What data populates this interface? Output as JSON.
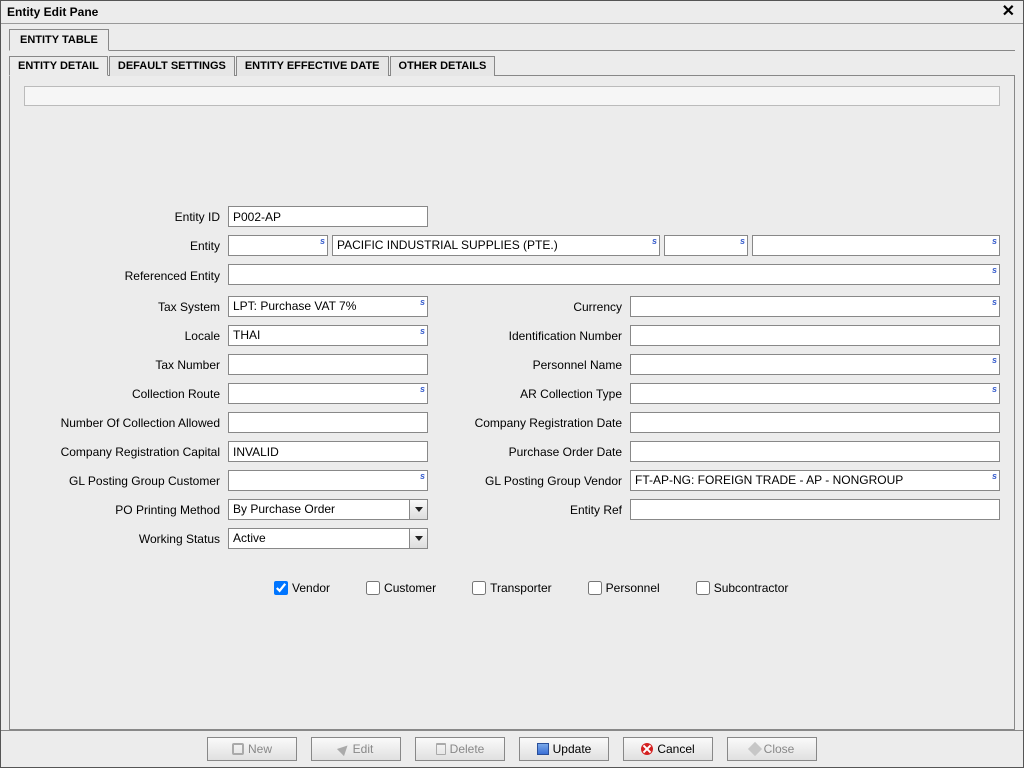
{
  "window": {
    "title": "Entity Edit Pane"
  },
  "outer_tabs": [
    {
      "label": "ENTITY TABLE"
    }
  ],
  "inner_tabs": [
    {
      "label": "ENTITY DETAIL"
    },
    {
      "label": "DEFAULT SETTINGS"
    },
    {
      "label": "ENTITY EFFECTIVE DATE"
    },
    {
      "label": "OTHER DETAILS"
    }
  ],
  "labels": {
    "entity_id": "Entity ID",
    "entity": "Entity",
    "referenced_entity": "Referenced Entity",
    "tax_system": "Tax System",
    "currency": "Currency",
    "locale": "Locale",
    "identification_number": "Identification Number",
    "tax_number": "Tax Number",
    "personnel_name": "Personnel Name",
    "collection_route": "Collection Route",
    "ar_collection_type": "AR Collection Type",
    "num_collection_allowed": "Number Of Collection Allowed",
    "company_registration_date": "Company Registration Date",
    "company_registration_capital": "Company Registration Capital",
    "purchase_order_date": "Purchase Order Date",
    "gl_posting_group_customer": "GL Posting Group Customer",
    "gl_posting_group_vendor": "GL Posting Group Vendor",
    "po_printing_method": "PO Printing Method",
    "entity_ref": "Entity Ref",
    "working_status": "Working Status"
  },
  "fields": {
    "entity_id": "P002-AP",
    "entity_prefix": "",
    "entity_name": "PACIFIC INDUSTRIAL SUPPLIES (PTE.)",
    "entity_aux1": "",
    "entity_aux2": "",
    "referenced_entity": "",
    "tax_system": "LPT: Purchase VAT 7%",
    "currency": "",
    "locale": "THAI",
    "identification_number": "",
    "tax_number": "",
    "personnel_name": "",
    "collection_route": "",
    "ar_collection_type": "",
    "num_collection_allowed": "",
    "company_registration_date": "",
    "company_registration_capital": "INVALID",
    "purchase_order_date": "",
    "gl_posting_group_customer": "",
    "gl_posting_group_vendor": "FT-AP-NG: FOREIGN TRADE - AP - NONGROUP",
    "po_printing_method": "By Purchase Order",
    "entity_ref": "",
    "working_status": "Active"
  },
  "checks": {
    "vendor": "Vendor",
    "customer": "Customer",
    "transporter": "Transporter",
    "personnel": "Personnel",
    "subcontractor": "Subcontractor"
  },
  "buttons": {
    "new": "New",
    "edit": "Edit",
    "delete": "Delete",
    "update": "Update",
    "cancel": "Cancel",
    "close": "Close"
  }
}
